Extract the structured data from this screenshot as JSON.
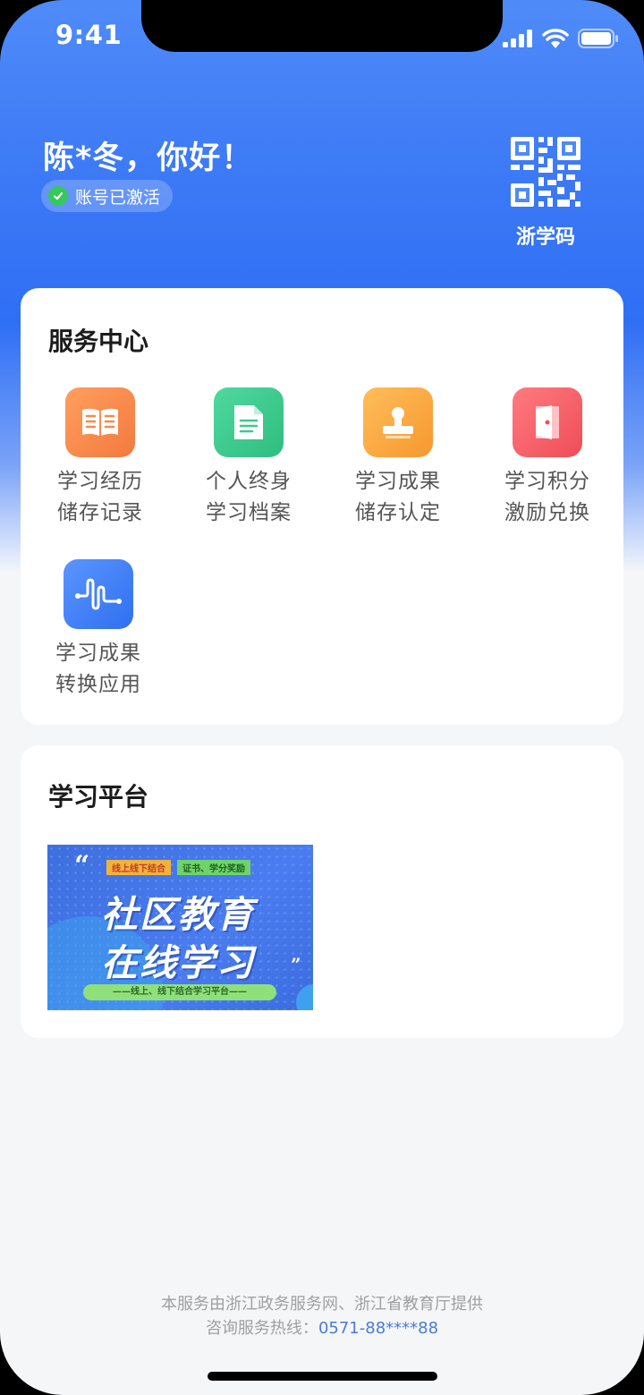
{
  "status_bar": {
    "time": "9:41"
  },
  "header": {
    "greeting": "陈*冬，你好！",
    "account_status": "账号已激活",
    "qr_label": "浙学码"
  },
  "service_center": {
    "title": "服务中心",
    "items": [
      {
        "line1": "学习经历",
        "line2": "储存记录",
        "icon": "book-icon",
        "color": "#f78a4b"
      },
      {
        "line1": "个人终身",
        "line2": "学习档案",
        "icon": "document-icon",
        "color": "#3fc98c"
      },
      {
        "line1": "学习成果",
        "line2": "储存认定",
        "icon": "stamp-icon",
        "color": "#f9a545"
      },
      {
        "line1": "学习积分",
        "line2": "激励兑换",
        "icon": "door-icon",
        "color": "#f36168"
      },
      {
        "line1": "学习成果",
        "line2": "转换应用",
        "icon": "waveform-icon",
        "color": "#3d7bf5"
      }
    ]
  },
  "platform": {
    "title": "学习平台",
    "banner": {
      "tag1": "线上线下结合",
      "tag2": "证书、学分奖励",
      "title_line1": "社区教育",
      "title_line2": "在线学习",
      "subtitle": "——线上、线下结合学习平台——"
    }
  },
  "footer": {
    "provider": "本服务由浙江政务服务网、浙江省教育厅提供",
    "hotline_label": "咨询服务热线：",
    "hotline_number": "0571-88****88"
  }
}
